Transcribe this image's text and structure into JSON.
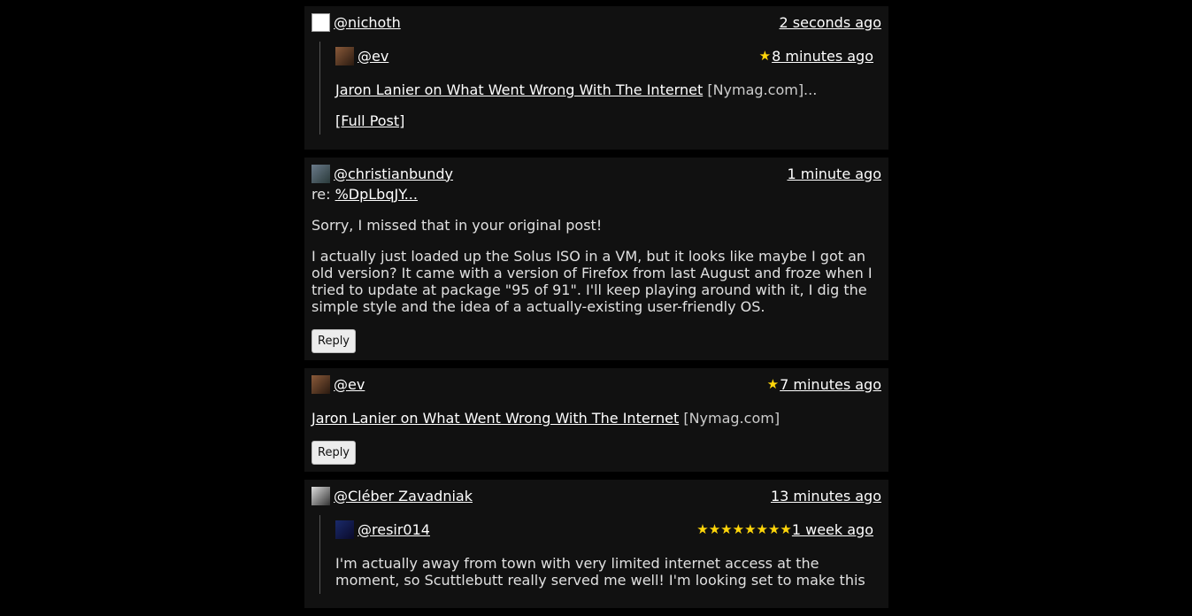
{
  "posts": [
    {
      "author": "@nichoth",
      "time": "2 seconds ago",
      "quoted": {
        "author": "@ev",
        "star": "★",
        "time": "8 minutes ago",
        "link": "Jaron Lanier on What Went Wrong With The Internet",
        "source": "[Nymag.com]...",
        "full_post": "[Full Post]"
      }
    },
    {
      "author": "@christianbundy",
      "time": "1 minute ago",
      "re_prefix": "re:",
      "re_link": "%DpLbqJY...",
      "paragraphs": [
        "Sorry, I missed that in your original post!",
        "I actually just loaded up the Solus ISO in a VM, but it looks like maybe I got an old version? It came with a version of Firefox from last August and froze when I tried to update at package \"95 of 91\". I'll keep playing around with it, I dig the simple style and the idea of a actually-existing user-friendly OS."
      ],
      "reply": "Reply"
    },
    {
      "author": "@ev",
      "star": "★",
      "time": "7 minutes ago",
      "link": "Jaron Lanier on What Went Wrong With The Internet",
      "source": "[Nymag.com]",
      "reply": "Reply"
    },
    {
      "author": "@Cléber Zavadniak",
      "time": "13 minutes ago",
      "quoted": {
        "author": "@resir014",
        "stars": "★★★★★★★★",
        "time": "1 week ago",
        "text": "I'm actually away from town with very limited internet access at the moment, so Scuttlebutt really served me well! I'm looking set to make this"
      }
    }
  ],
  "colors": {
    "background": "#000000",
    "card": "#111111",
    "star": "#ffd60a"
  }
}
